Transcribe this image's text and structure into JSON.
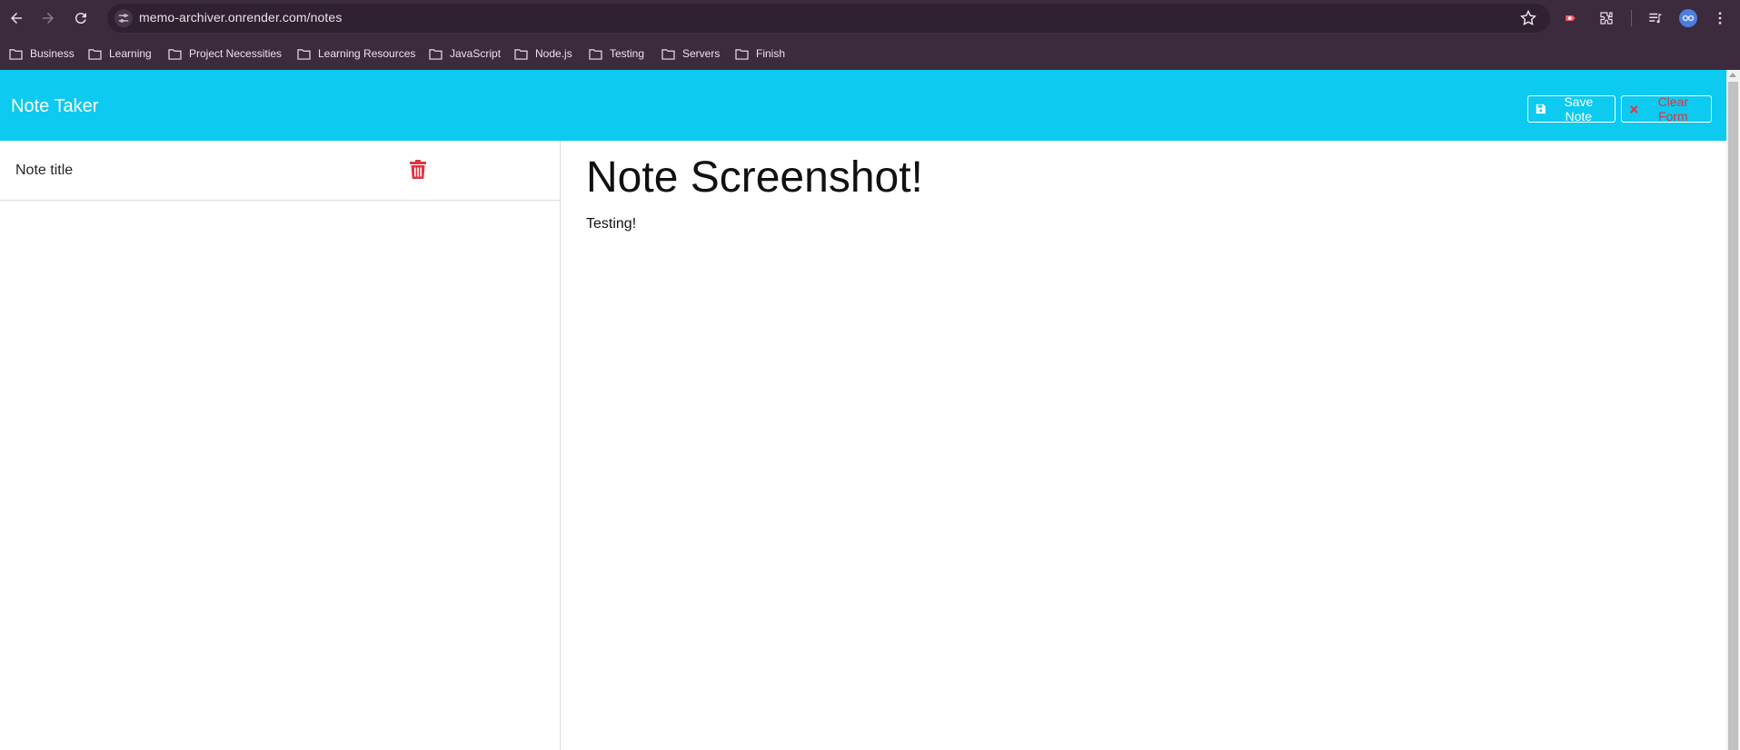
{
  "browser": {
    "url": "memo-archiver.onrender.com/notes",
    "bookmarks": [
      "Business",
      "Learning",
      "Project Necessities",
      "Learning Resources",
      "JavaScript",
      "Node.js",
      "Testing",
      "Servers",
      "Finish"
    ]
  },
  "app": {
    "brand": "Note Taker",
    "save_label": "Save Note",
    "clear_label": "Clear Form",
    "accent_color": "#0dcaf0",
    "danger_color": "#dc3545"
  },
  "notes": [
    {
      "title": "Note title"
    }
  ],
  "active_note": {
    "title": "Note Screenshot!",
    "text": "Testing!"
  }
}
